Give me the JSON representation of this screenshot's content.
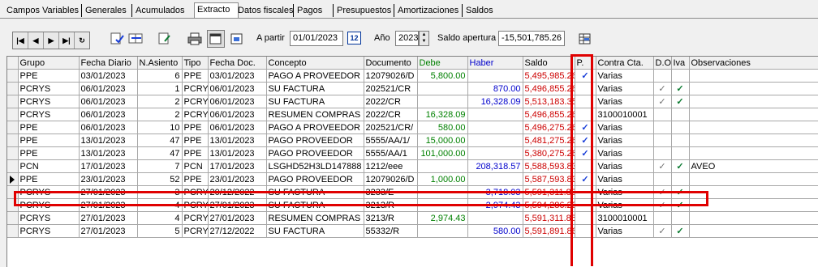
{
  "tabs": [
    {
      "label": "Campos Variables",
      "active": false
    },
    {
      "label": "Generales",
      "active": false
    },
    {
      "label": "Acumulados",
      "active": false
    },
    {
      "label": "Extracto",
      "active": true
    },
    {
      "label": "Datos fiscales",
      "active": false
    },
    {
      "label": "Pagos",
      "active": false
    },
    {
      "label": "Presupuestos",
      "active": false
    },
    {
      "label": "Amortizaciones",
      "active": false
    },
    {
      "label": "Saldos",
      "active": false
    }
  ],
  "toolbar": {
    "nav": [
      "|◀",
      "◀",
      "▶",
      "▶|",
      "↻"
    ],
    "a_partir_label": "A partir",
    "a_partir_value": "01/01/2023",
    "calendar_label": "12",
    "ano_label": "Año",
    "ano_value": "2023",
    "saldo_label": "Saldo apertura",
    "saldo_value": "-15,501,785.26"
  },
  "columns": [
    "Grupo",
    "Fecha Diario",
    "N.Asiento",
    "Tipo",
    "Fecha Doc.",
    "Concepto",
    "Documento",
    "Debe",
    "Haber",
    "Saldo",
    "P.",
    "Contra Cta.",
    "D.O",
    "Iva",
    "Observaciones"
  ],
  "colors": {
    "debe": "#008000",
    "haber": "#0000cc",
    "saldo": "#cc0000",
    "highlight": "#e00000",
    "check_blue": "#1a3fd8",
    "check_green": "#0a7a30"
  },
  "rows": [
    {
      "grupo": "PPE",
      "fecha": "03/01/2023",
      "asiento": "6",
      "tipo": "PPE",
      "fdoc": "03/01/2023",
      "concepto": "PAGO A PROVEEDOR",
      "doc": "12079026/D",
      "debe": "5,800.00",
      "haber": "",
      "saldo": "5,495,985.26",
      "p": true,
      "contra": "Varias",
      "do": false,
      "iva": false,
      "obs": ""
    },
    {
      "grupo": "PCRYS",
      "fecha": "06/01/2023",
      "asiento": "1",
      "tipo": "PCRY",
      "fdoc": "06/01/2023",
      "concepto": "SU FACTURA",
      "doc": "202521/CR",
      "debe": "",
      "haber": "870.00",
      "saldo": "5,496,855.26",
      "p": false,
      "contra": "Varias",
      "do": true,
      "iva": true,
      "obs": ""
    },
    {
      "grupo": "PCRYS",
      "fecha": "06/01/2023",
      "asiento": "2",
      "tipo": "PCRY",
      "fdoc": "06/01/2023",
      "concepto": "SU FACTURA",
      "doc": "2022/CR",
      "debe": "",
      "haber": "16,328.09",
      "saldo": "5,513,183.35",
      "p": false,
      "contra": "Varias",
      "do": true,
      "iva": true,
      "obs": ""
    },
    {
      "grupo": "PCRYS",
      "fecha": "06/01/2023",
      "asiento": "2",
      "tipo": "PCRY",
      "fdoc": "06/01/2023",
      "concepto": "RESUMEN COMPRAS",
      "doc": "2022/CR",
      "debe": "16,328.09",
      "haber": "",
      "saldo": "5,496,855.26",
      "p": false,
      "contra": "3100010001",
      "do": false,
      "iva": false,
      "obs": ""
    },
    {
      "grupo": "PPE",
      "fecha": "06/01/2023",
      "asiento": "10",
      "tipo": "PPE",
      "fdoc": "06/01/2023",
      "concepto": "PAGO A PROVEEDOR",
      "doc": "202521/CR/",
      "debe": "580.00",
      "haber": "",
      "saldo": "5,496,275.26",
      "p": true,
      "contra": "Varias",
      "do": false,
      "iva": false,
      "obs": ""
    },
    {
      "grupo": "PPE",
      "fecha": "13/01/2023",
      "asiento": "47",
      "tipo": "PPE",
      "fdoc": "13/01/2023",
      "concepto": "PAGO PROVEEDOR",
      "doc": "5555/AA/1/",
      "debe": "15,000.00",
      "haber": "",
      "saldo": "5,481,275.26",
      "p": true,
      "contra": "Varias",
      "do": false,
      "iva": false,
      "obs": ""
    },
    {
      "grupo": "PPE",
      "fecha": "13/01/2023",
      "asiento": "47",
      "tipo": "PPE",
      "fdoc": "13/01/2023",
      "concepto": "PAGO PROVEEDOR",
      "doc": "5555/AA/1",
      "debe": "101,000.00",
      "haber": "",
      "saldo": "5,380,275.26",
      "p": true,
      "contra": "Varias",
      "do": false,
      "iva": false,
      "obs": ""
    },
    {
      "grupo": "PCN",
      "fecha": "17/01/2023",
      "asiento": "7",
      "tipo": "PCN",
      "fdoc": "17/01/2023",
      "concepto": "LSGHD52H3LD147888",
      "doc": "1212/eee",
      "debe": "",
      "haber": "208,318.57",
      "saldo": "5,588,593.83",
      "p": false,
      "contra": "Varias",
      "do": true,
      "iva": true,
      "obs": "AVEO"
    },
    {
      "grupo": "PPE",
      "fecha": "23/01/2023",
      "asiento": "52",
      "tipo": "PPE",
      "fdoc": "23/01/2023",
      "concepto": "PAGO PROVEEDOR",
      "doc": "12079026/D",
      "debe": "1,000.00",
      "haber": "",
      "saldo": "5,587,593.83",
      "p": true,
      "contra": "Varias",
      "do": false,
      "iva": false,
      "obs": "",
      "current": true
    },
    {
      "grupo": "PCRYS",
      "fecha": "27/01/2023",
      "asiento": "3",
      "tipo": "PCRY",
      "fdoc": "20/12/2022",
      "concepto": "SU FACTURA",
      "doc": "3233/E",
      "debe": "",
      "haber": "3,718.03",
      "saldo": "5,591,311.86",
      "p": false,
      "contra": "Varias",
      "do": true,
      "iva": true,
      "obs": ""
    },
    {
      "grupo": "PCRYS",
      "fecha": "27/01/2023",
      "asiento": "4",
      "tipo": "PCRY",
      "fdoc": "27/01/2023",
      "concepto": "SU FACTURA",
      "doc": "3213/R",
      "debe": "",
      "haber": "2,974.43",
      "saldo": "5,594,286.29",
      "p": false,
      "contra": "Varias",
      "do": true,
      "iva": true,
      "obs": ""
    },
    {
      "grupo": "PCRYS",
      "fecha": "27/01/2023",
      "asiento": "4",
      "tipo": "PCRY",
      "fdoc": "27/01/2023",
      "concepto": "RESUMEN COMPRAS",
      "doc": "3213/R",
      "debe": "2,974.43",
      "haber": "",
      "saldo": "5,591,311.86",
      "p": false,
      "contra": "3100010001",
      "do": false,
      "iva": false,
      "obs": ""
    },
    {
      "grupo": "PCRYS",
      "fecha": "27/01/2023",
      "asiento": "5",
      "tipo": "PCRY",
      "fdoc": "27/12/2022",
      "concepto": "SU FACTURA",
      "doc": "55332/R",
      "debe": "",
      "haber": "580.00",
      "saldo": "5,591,891.86",
      "p": false,
      "contra": "Varias",
      "do": true,
      "iva": true,
      "obs": ""
    }
  ]
}
